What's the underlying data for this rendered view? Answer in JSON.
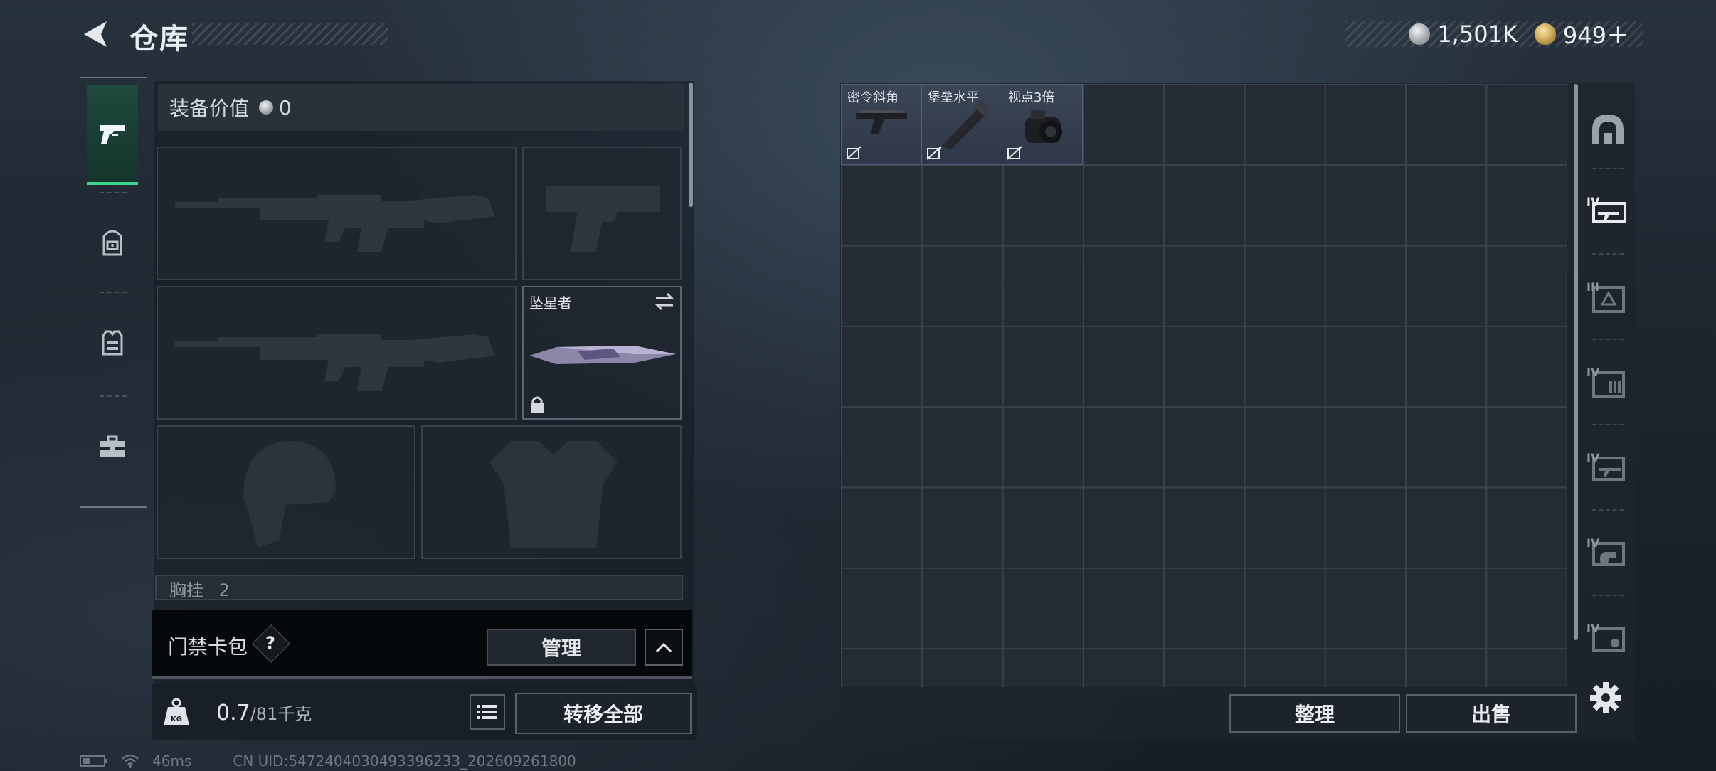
{
  "header": {
    "title": "仓库",
    "currency": [
      {
        "icon": "silver-coin-icon",
        "value": "1,501K"
      },
      {
        "icon": "gold-coin-icon",
        "value": "949＋"
      }
    ]
  },
  "left_tabs": [
    {
      "name": "weapons",
      "icon": "pistol-icon",
      "active": true
    },
    {
      "name": "gear",
      "icon": "backpack-icon",
      "active": false
    },
    {
      "name": "vest",
      "icon": "vest-icon",
      "active": false
    },
    {
      "name": "toolbox",
      "icon": "toolbox-icon",
      "active": false
    }
  ],
  "equipment": {
    "value_label": "装备价值",
    "value": "0",
    "melee_name": "坠星者",
    "chest_label": "胸挂",
    "chest_count": "2"
  },
  "keycard": {
    "label": "门禁卡包",
    "help": "?",
    "manage_label": "管理"
  },
  "weight": {
    "current": "0.7",
    "max": "/81千克",
    "kg_label": "KG",
    "transfer_label": "转移全部"
  },
  "status": {
    "ping": "46ms",
    "uid": "CN UID:5472404030493396233_202609261800"
  },
  "stash": {
    "items": [
      {
        "name": "密令斜角",
        "icon": "angled-grip-icon"
      },
      {
        "name": "堡垒水平",
        "icon": "flashlight-icon"
      },
      {
        "name": "视点3倍",
        "icon": "scope-icon"
      }
    ],
    "sort_label": "整理",
    "sell_label": "出售"
  },
  "categories": [
    {
      "icon": "dome-icon",
      "tier": ""
    },
    {
      "icon": "weapon-case-icon",
      "tier": "IV"
    },
    {
      "icon": "medkit-case-icon",
      "tier": "III"
    },
    {
      "icon": "ammo-case-icon",
      "tier": "IV"
    },
    {
      "icon": "tool-case-icon",
      "tier": "IV"
    },
    {
      "icon": "hand-case-icon",
      "tier": "IV"
    },
    {
      "icon": "misc-case-icon",
      "tier": "IV"
    }
  ],
  "colors": {
    "accent_green": "#3ad38f",
    "stash_item_bg": "#3a4556"
  }
}
